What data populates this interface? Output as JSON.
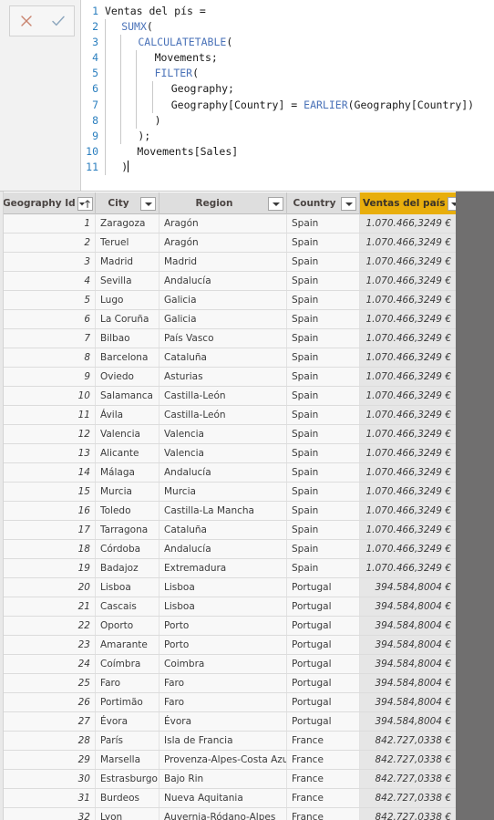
{
  "formula_bar": {
    "cancel_label": "Cancel",
    "commit_label": "Commit",
    "lines": [
      {
        "n": "1",
        "indent": 0,
        "guides": 0,
        "tokens": [
          {
            "t": "Ventas del pís =",
            "k": "plain"
          }
        ]
      },
      {
        "n": "2",
        "indent": 1,
        "guides": 1,
        "tokens": [
          {
            "t": "SUMX",
            "k": "kw"
          },
          {
            "t": "(",
            "k": "plain"
          }
        ]
      },
      {
        "n": "3",
        "indent": 2,
        "guides": 2,
        "tokens": [
          {
            "t": "CALCULATETABLE",
            "k": "kw"
          },
          {
            "t": "(",
            "k": "plain"
          }
        ]
      },
      {
        "n": "4",
        "indent": 3,
        "guides": 3,
        "tokens": [
          {
            "t": "Movements;",
            "k": "plain"
          }
        ]
      },
      {
        "n": "5",
        "indent": 3,
        "guides": 3,
        "tokens": [
          {
            "t": "FILTER",
            "k": "kw"
          },
          {
            "t": "(",
            "k": "plain"
          }
        ]
      },
      {
        "n": "6",
        "indent": 4,
        "guides": 4,
        "tokens": [
          {
            "t": "Geography;",
            "k": "plain"
          }
        ]
      },
      {
        "n": "7",
        "indent": 4,
        "guides": 4,
        "tokens": [
          {
            "t": "Geography[Country] = ",
            "k": "plain"
          },
          {
            "t": "EARLIER",
            "k": "kw"
          },
          {
            "t": "(Geography[Country])",
            "k": "plain"
          }
        ]
      },
      {
        "n": "8",
        "indent": 3,
        "guides": 3,
        "tokens": [
          {
            "t": ")",
            "k": "plain"
          }
        ]
      },
      {
        "n": "9",
        "indent": 2,
        "guides": 2,
        "tokens": [
          {
            "t": ");",
            "k": "plain"
          }
        ]
      },
      {
        "n": "10",
        "indent": 2,
        "guides": 1,
        "tokens": [
          {
            "t": "Movements[Sales]",
            "k": "plain"
          }
        ]
      },
      {
        "n": "11",
        "indent": 1,
        "guides": 1,
        "tokens": [
          {
            "t": ")",
            "k": "plain"
          }
        ],
        "caret": true
      }
    ]
  },
  "grid": {
    "columns": [
      {
        "label": "Geography Id",
        "icon": "sort-ascending-filter-icon",
        "align": "right",
        "highlighted": false
      },
      {
        "label": "City",
        "icon": "filter-dropdown-icon",
        "align": "left",
        "highlighted": false
      },
      {
        "label": "Region",
        "icon": "filter-dropdown-icon",
        "align": "left",
        "highlighted": false
      },
      {
        "label": "Country",
        "icon": "filter-dropdown-icon",
        "align": "left",
        "highlighted": false
      },
      {
        "label": "Ventas del país",
        "icon": "filter-dropdown-icon",
        "align": "right",
        "highlighted": true
      }
    ],
    "rows": [
      [
        "1",
        "Zaragoza",
        "Aragón",
        "Spain",
        "1.070.466,3249 €"
      ],
      [
        "2",
        "Teruel",
        "Aragón",
        "Spain",
        "1.070.466,3249 €"
      ],
      [
        "3",
        "Madrid",
        "Madrid",
        "Spain",
        "1.070.466,3249 €"
      ],
      [
        "4",
        "Sevilla",
        "Andalucía",
        "Spain",
        "1.070.466,3249 €"
      ],
      [
        "5",
        "Lugo",
        "Galicia",
        "Spain",
        "1.070.466,3249 €"
      ],
      [
        "6",
        "La Coruña",
        "Galicia",
        "Spain",
        "1.070.466,3249 €"
      ],
      [
        "7",
        "Bilbao",
        "País Vasco",
        "Spain",
        "1.070.466,3249 €"
      ],
      [
        "8",
        "Barcelona",
        "Cataluña",
        "Spain",
        "1.070.466,3249 €"
      ],
      [
        "9",
        "Oviedo",
        "Asturias",
        "Spain",
        "1.070.466,3249 €"
      ],
      [
        "10",
        "Salamanca",
        "Castilla-León",
        "Spain",
        "1.070.466,3249 €"
      ],
      [
        "11",
        "Ávila",
        "Castilla-León",
        "Spain",
        "1.070.466,3249 €"
      ],
      [
        "12",
        "Valencia",
        "Valencia",
        "Spain",
        "1.070.466,3249 €"
      ],
      [
        "13",
        "Alicante",
        "Valencia",
        "Spain",
        "1.070.466,3249 €"
      ],
      [
        "14",
        "Málaga",
        "Andalucía",
        "Spain",
        "1.070.466,3249 €"
      ],
      [
        "15",
        "Murcia",
        "Murcia",
        "Spain",
        "1.070.466,3249 €"
      ],
      [
        "16",
        "Toledo",
        "Castilla-La Mancha",
        "Spain",
        "1.070.466,3249 €"
      ],
      [
        "17",
        "Tarragona",
        "Cataluña",
        "Spain",
        "1.070.466,3249 €"
      ],
      [
        "18",
        "Córdoba",
        "Andalucía",
        "Spain",
        "1.070.466,3249 €"
      ],
      [
        "19",
        "Badajoz",
        "Extremadura",
        "Spain",
        "1.070.466,3249 €"
      ],
      [
        "20",
        "Lisboa",
        "Lisboa",
        "Portugal",
        "394.584,8004 €"
      ],
      [
        "21",
        "Cascais",
        "Lisboa",
        "Portugal",
        "394.584,8004 €"
      ],
      [
        "22",
        "Oporto",
        "Porto",
        "Portugal",
        "394.584,8004 €"
      ],
      [
        "23",
        "Amarante",
        "Porto",
        "Portugal",
        "394.584,8004 €"
      ],
      [
        "24",
        "Coímbra",
        "Coimbra",
        "Portugal",
        "394.584,8004 €"
      ],
      [
        "25",
        "Faro",
        "Faro",
        "Portugal",
        "394.584,8004 €"
      ],
      [
        "26",
        "Portimão",
        "Faro",
        "Portugal",
        "394.584,8004 €"
      ],
      [
        "27",
        "Évora",
        "Évora",
        "Portugal",
        "394.584,8004 €"
      ],
      [
        "28",
        "París",
        "Isla de Francia",
        "France",
        "842.727,0338 €"
      ],
      [
        "29",
        "Marsella",
        "Provenza-Alpes-Costa Azul",
        "France",
        "842.727,0338 €"
      ],
      [
        "30",
        "Estrasburgo",
        "Bajo Rin",
        "France",
        "842.727,0338 €"
      ],
      [
        "31",
        "Burdeos",
        "Nueva Aquitania",
        "France",
        "842.727,0338 €"
      ],
      [
        "32",
        "Lyon",
        "Auvernia-Ródano-Alpes",
        "France",
        "842.727,0338 €"
      ]
    ]
  },
  "colors": {
    "header_highlight": "#e8ae0c",
    "header_background": "#dedede",
    "row_background": "#f8f8f8",
    "measure_cell_background": "#e6e6e6",
    "gutter": "#706f6f",
    "line_number": "#2b7fbf",
    "keyword": "#4a72b8"
  }
}
